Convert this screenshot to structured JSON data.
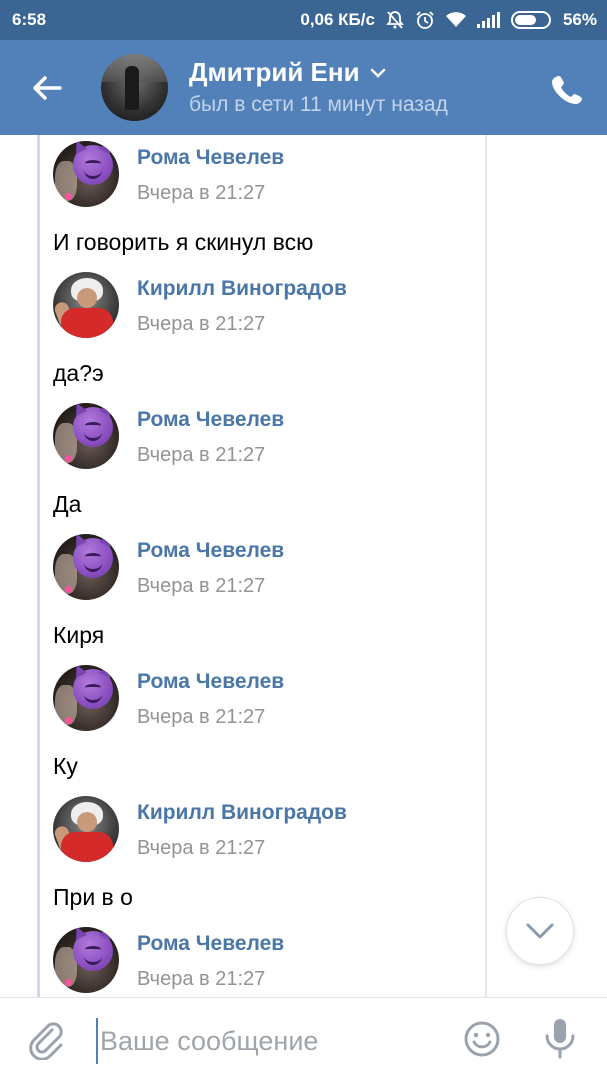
{
  "status_bar": {
    "time": "6:58",
    "speed": "0,06 КБ/с",
    "battery": "56%"
  },
  "header": {
    "contact_name": "Дмитрий Ени",
    "last_seen": "был в сети 11 минут назад",
    "icons": [
      "back-arrow-icon",
      "chevron-down-icon",
      "phone-icon"
    ]
  },
  "messages": [
    {
      "author": "Рома Чевелев",
      "time": "Вчера в 21:27",
      "text": "И говорить я скинул всю"
    },
    {
      "author": "Кирилл Виноградов",
      "time": "Вчера в 21:27",
      "text": "да?э"
    },
    {
      "author": "Рома Чевелев",
      "time": "Вчера в 21:27",
      "text": "Да"
    },
    {
      "author": "Рома Чевелев",
      "time": "Вчера в 21:27",
      "text": "Киря"
    },
    {
      "author": "Рома Чевелев",
      "time": "Вчера в 21:27",
      "text": "Ку"
    },
    {
      "author": "Кирилл Виноградов",
      "time": "Вчера в 21:27",
      "text": "При в о"
    },
    {
      "author": "Рома Чевелев",
      "time": "Вчера в 21:27",
      "text": ""
    }
  ],
  "composer": {
    "placeholder": "Ваше сообщение",
    "value": ""
  },
  "colors": {
    "status_bar": "#3b6593",
    "header": "#5181b8",
    "author_link": "#4a76a8",
    "time_text": "#939393"
  }
}
